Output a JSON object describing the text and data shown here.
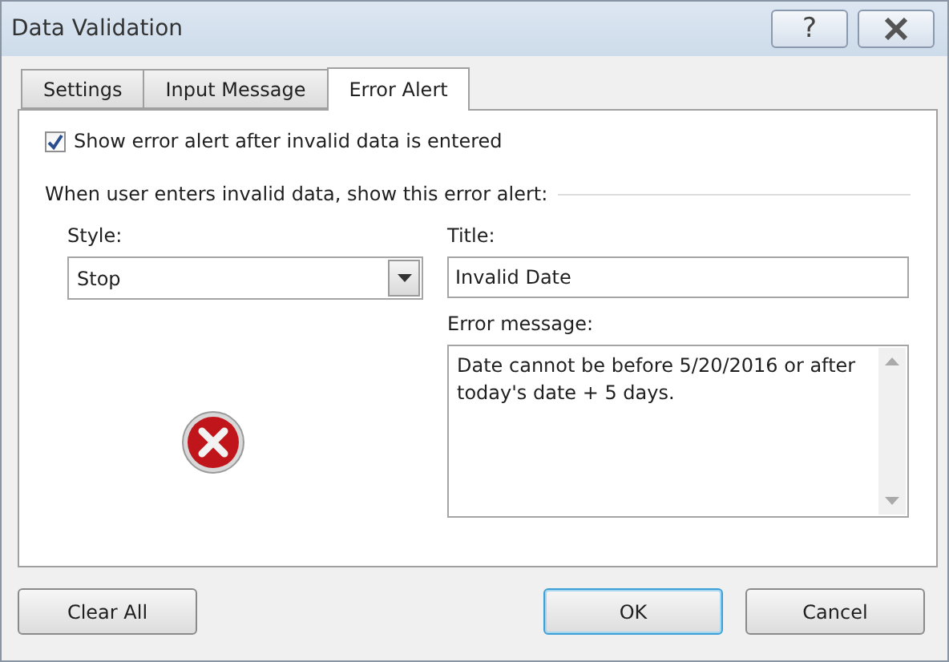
{
  "window": {
    "title": "Data Validation",
    "buttons": [
      {
        "kind": "help",
        "label": "?"
      },
      {
        "kind": "close"
      }
    ]
  },
  "tabs": [
    {
      "label": "Settings",
      "selected": false
    },
    {
      "label": "Input Message",
      "selected": false
    },
    {
      "label": "Error Alert",
      "selected": true
    }
  ],
  "show_alert": {
    "label": "Show error alert after invalid data is entered",
    "checked": true
  },
  "group_label": "When user enters invalid data, show this error alert:",
  "style": {
    "label": "Style:",
    "value": "Stop",
    "kind": "stop"
  },
  "title_field": {
    "label": "Title:",
    "value": "Invalid Date"
  },
  "message_field": {
    "label": "Error message:",
    "value": "Date cannot be before 5/20/2016 or after today's date + 5 days."
  },
  "buttons": [
    {
      "label": "Clear All",
      "kind": "left",
      "default": false
    },
    {
      "label": "OK",
      "kind": "right",
      "default": true
    },
    {
      "label": "Cancel",
      "kind": "right",
      "default": false
    }
  ]
}
